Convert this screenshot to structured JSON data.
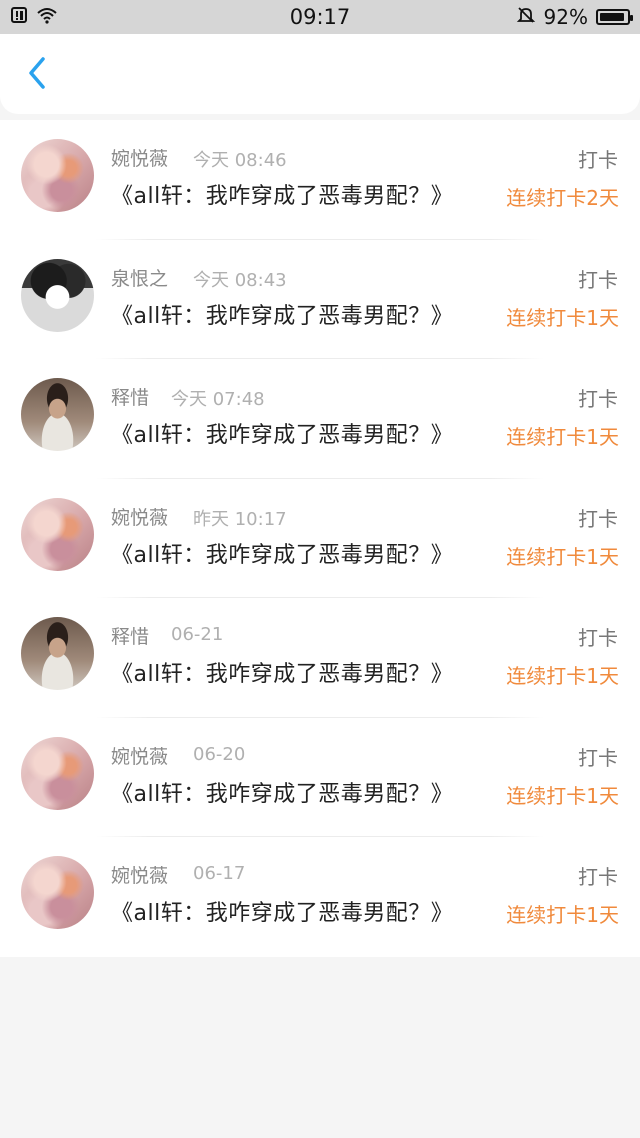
{
  "status_bar": {
    "time": "09:17",
    "battery_text": "92%",
    "battery_level": 0.92
  },
  "nav": {
    "back_icon": "chevron-left-icon",
    "accent_color": "#2aa2ee"
  },
  "items": [
    {
      "name": "婉悦薇",
      "time": "今天 08:46",
      "title": "《all轩：我咋穿成了恶毒男配？》",
      "action": "打卡",
      "streak": "连续打卡2天",
      "avatar": "girl"
    },
    {
      "name": "泉恨之",
      "time": "今天 08:43",
      "title": "《all轩：我咋穿成了恶毒男配？》",
      "action": "打卡",
      "streak": "连续打卡1天",
      "avatar": "cartoon"
    },
    {
      "name": "释惜",
      "time": "今天 07:48",
      "title": "《all轩：我咋穿成了恶毒男配？》",
      "action": "打卡",
      "streak": "连续打卡1天",
      "avatar": "man"
    },
    {
      "name": "婉悦薇",
      "time": "昨天 10:17",
      "title": "《all轩：我咋穿成了恶毒男配？》",
      "action": "打卡",
      "streak": "连续打卡1天",
      "avatar": "girl"
    },
    {
      "name": "释惜",
      "time": "06-21",
      "title": "《all轩：我咋穿成了恶毒男配？》",
      "action": "打卡",
      "streak": "连续打卡1天",
      "avatar": "man"
    },
    {
      "name": "婉悦薇",
      "time": "06-20",
      "title": "《all轩：我咋穿成了恶毒男配？》",
      "action": "打卡",
      "streak": "连续打卡1天",
      "avatar": "girl"
    },
    {
      "name": "婉悦薇",
      "time": "06-17",
      "title": "《all轩：我咋穿成了恶毒男配？》",
      "action": "打卡",
      "streak": "连续打卡1天",
      "avatar": "girl"
    }
  ],
  "colors": {
    "streak": "#f08a3c",
    "name": "#8a8a8a",
    "time": "#b0b0b0",
    "background": "#f5f5f5"
  }
}
